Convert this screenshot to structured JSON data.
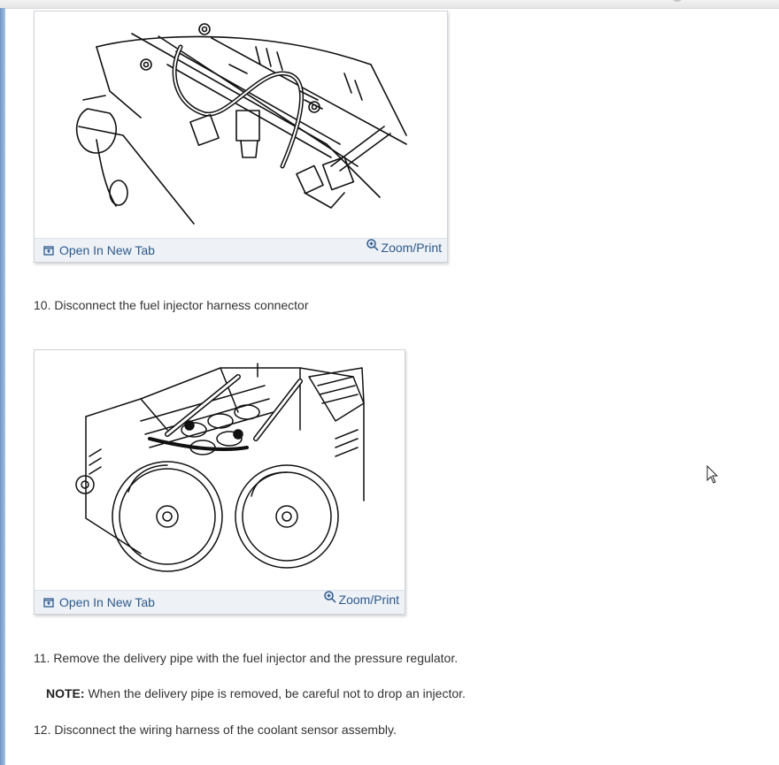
{
  "figures": [
    {
      "open_label": "Open In New Tab",
      "zoom_label": "Zoom/Print"
    },
    {
      "open_label": "Open In New Tab",
      "zoom_label": "Zoom/Print"
    }
  ],
  "steps": {
    "s10": "10. Disconnect the fuel injector harness connector",
    "s11": "11. Remove the delivery pipe with the fuel injector and the pressure regulator.",
    "note_label": "NOTE:",
    "note_text": " When the delivery pipe is removed, be careful not to drop an injector.",
    "s12": "12. Disconnect the wiring harness of the coolant sensor assembly."
  },
  "colors": {
    "link": "#2d5a8c",
    "bar_bg": "#eef1f6",
    "rail": "#6f95c4"
  },
  "icons": [
    "open-in-new-tab-icon",
    "zoom-icon",
    "mouse-cursor-icon"
  ]
}
